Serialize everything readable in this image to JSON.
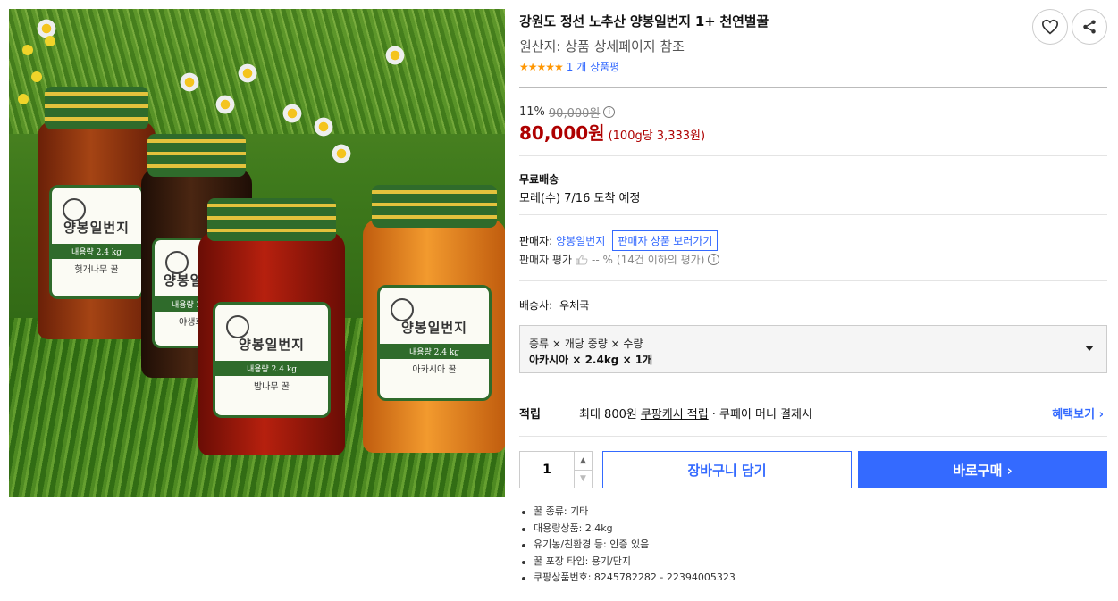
{
  "product": {
    "title": "강원도 정선 노추산 양봉일번지 1+ 천연벌꿀",
    "origin": "원산지: 상품 상세페이지 참조",
    "stars": "★★★★★",
    "review_count": "1 개 상품평"
  },
  "image": {
    "jars": [
      {
        "brand": "양봉일번지",
        "band": "내용량 2.4 kg",
        "kind": "헛개나무 꿀",
        "color": "#8a2f0c"
      },
      {
        "brand": "양봉일번지",
        "band": "내용량 2.4 kg",
        "kind": "야생화 꿀",
        "color": "#3a1d0c"
      },
      {
        "brand": "양봉일번지",
        "band": "내용량 2.4 kg",
        "kind": "밤나무 꿀",
        "color": "#9e1a0a"
      },
      {
        "brand": "양봉일번지",
        "band": "내용량 2.4 kg",
        "kind": "아카시아 꿀",
        "color": "#e07a1a"
      }
    ]
  },
  "price": {
    "discount_rate": "11%",
    "original": "90,000원",
    "final": "80,000원",
    "unit_price": "(100g당 3,333원)"
  },
  "shipping": {
    "label": "무료배송",
    "eta": "모레(수) 7/16 도착 예정"
  },
  "seller": {
    "label": "판매자:",
    "name": "양봉일번지",
    "products_button": "판매자 상품 보러가기",
    "rating_label": "판매자 평가",
    "rating_value": "-- %",
    "rating_note": "(14건 이하의 평가)"
  },
  "carrier": {
    "label": "배송사:",
    "name": "우체국"
  },
  "option": {
    "header": "종류 × 개당 중량 × 수량",
    "value": "아카시아 × 2.4kg × 1개"
  },
  "reward": {
    "label": "적립",
    "prefix": "최대 800원",
    "link": "쿠팡캐시 적립",
    "suffix": "· 쿠페이 머니 결제시",
    "more": "혜택보기 ›"
  },
  "purchase": {
    "quantity": "1",
    "cart_label": "장바구니 담기",
    "buy_label": "바로구매 ›"
  },
  "attributes": [
    "꿀 종류: 기타",
    "대용량상품: 2.4kg",
    "유기농/친환경 등: 인증 있음",
    "꿀 포장 타입: 용기/단지",
    "쿠팡상품번호: 8245782282 - 22394005323"
  ],
  "colors": {
    "accent": "#346aff",
    "price": "#ae0000",
    "star": "#ff9600"
  },
  "icons": {
    "wishlist": "heart-icon",
    "share": "share-icon",
    "info": "info-icon",
    "thumb": "thumb-up-icon",
    "caret": "caret-down-icon"
  }
}
